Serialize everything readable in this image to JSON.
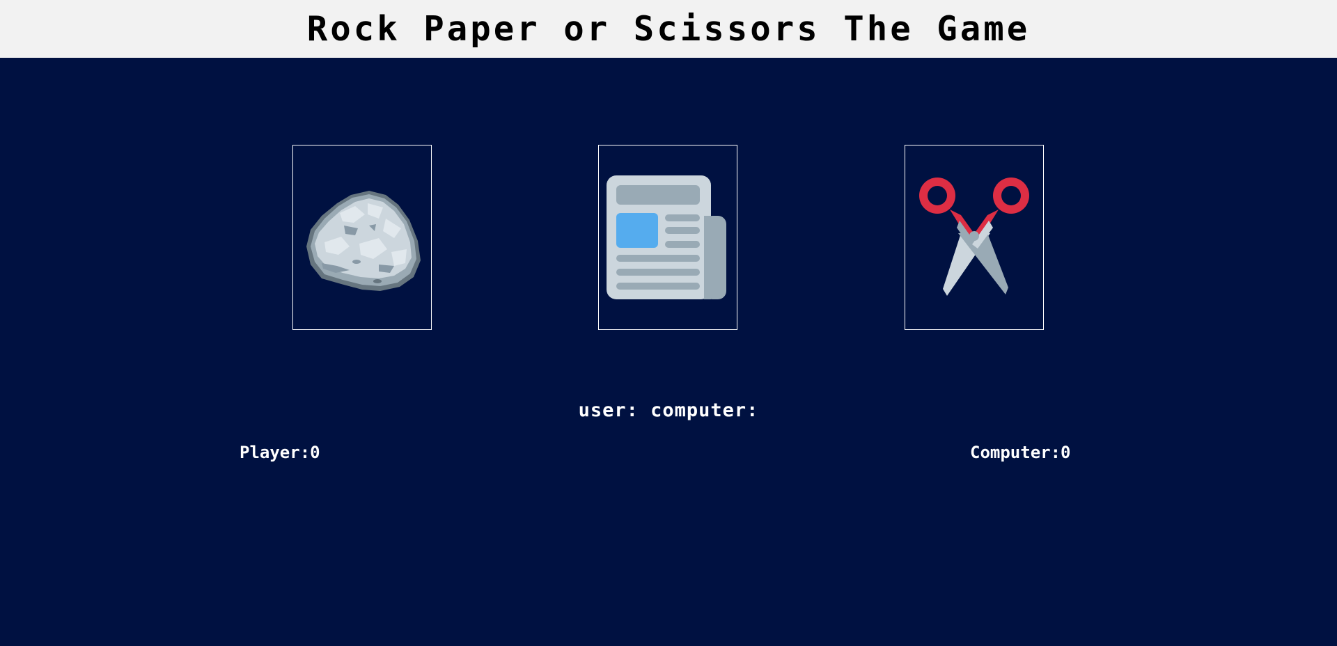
{
  "header": {
    "title": "Rock Paper or Scissors The Game"
  },
  "choices": [
    {
      "id": "rock",
      "icon": "rock-icon"
    },
    {
      "id": "paper",
      "icon": "newspaper-icon"
    },
    {
      "id": "scissors",
      "icon": "scissors-icon"
    }
  ],
  "status": {
    "user_label": "user:",
    "user_choice": "",
    "computer_label": "computer:",
    "computer_choice": ""
  },
  "scores": {
    "player_label": "Player:",
    "player_score": "0",
    "computer_label": "Computer:",
    "computer_score": "0"
  },
  "colors": {
    "background": "#001141",
    "header_bg": "#f2f2f2",
    "card_border": "#ffffff",
    "text": "#ffffff"
  }
}
